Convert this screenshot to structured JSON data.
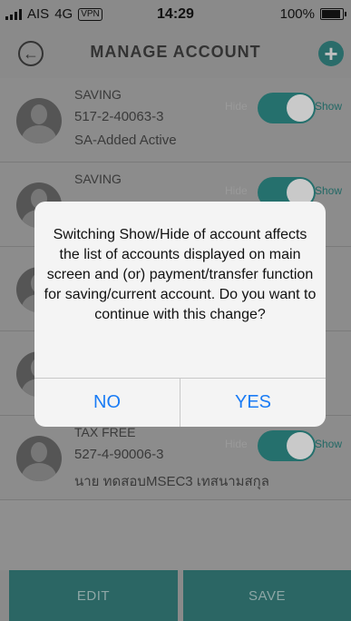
{
  "status_bar": {
    "carrier": "AIS",
    "network": "4G",
    "vpn": "VPN",
    "time": "14:29",
    "battery": "100%",
    "battery_level": 1.0
  },
  "header": {
    "title": "MANAGE ACCOUNT",
    "back_icon": "back-arrow-icon",
    "add_icon": "plus-icon"
  },
  "toggle_labels": {
    "hide": "Hide",
    "show": "Show"
  },
  "accounts": [
    {
      "type": "SAVING",
      "number": "517-2-40063-3",
      "status": "SA-Added Active"
    },
    {
      "type": "SAVING",
      "number": "",
      "status": ""
    },
    {
      "type": "",
      "number": "",
      "status": ""
    },
    {
      "type": "",
      "number": "",
      "status": ""
    },
    {
      "type": "TAX FREE",
      "number": "527-4-90006-3",
      "status": "นาย ทดสอบMSEC3 เทสนามสกุล"
    }
  ],
  "footer": {
    "edit": "EDIT",
    "save": "SAVE"
  },
  "dialog": {
    "message": "Switching Show/Hide of account affects the list of accounts displayed on main screen and (or) payment/transfer function for saving/current account. Do you want to continue with this change?",
    "no": "NO",
    "yes": "YES"
  },
  "colors": {
    "accent": "#25706d",
    "dialog_button": "#1a7cf5",
    "overlay_bg": "#8f8f8f"
  }
}
